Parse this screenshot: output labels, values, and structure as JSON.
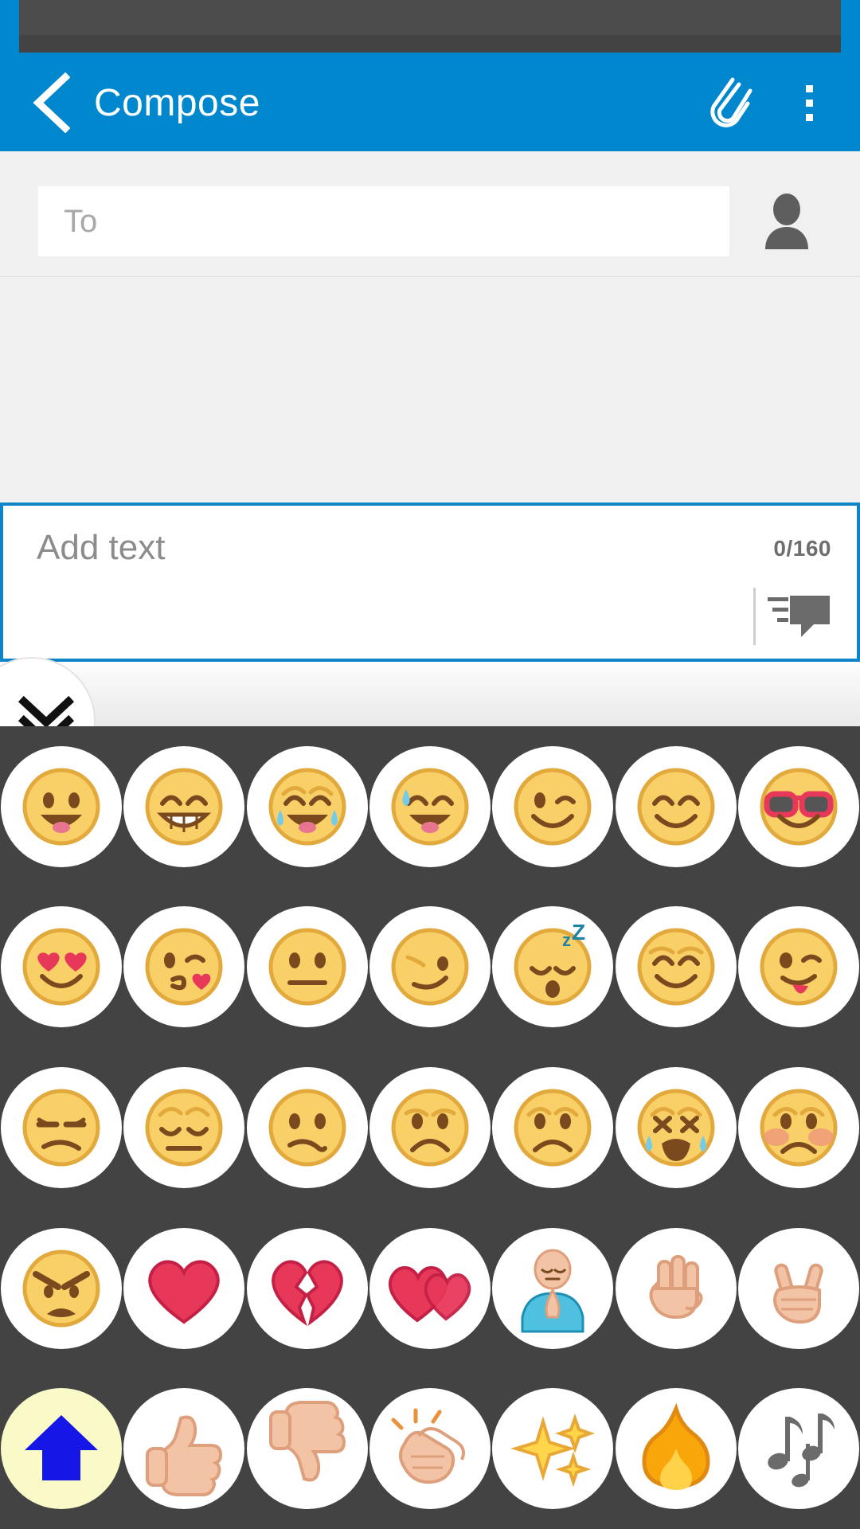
{
  "app": {
    "title": "Compose",
    "accent_color": "#0087cd",
    "keyboard_bg": "#434343",
    "key_bg": "#ffffff",
    "shift_key_bg": "#fafac8"
  },
  "appbar": {
    "back_label": "back-arrow",
    "title": "Compose",
    "attach_label": "attach",
    "overflow_label": "more options"
  },
  "recipient": {
    "placeholder": "To",
    "value": "",
    "contact_picker_label": "contacts"
  },
  "compose": {
    "placeholder": "Add text",
    "value": "",
    "counter": "0/160",
    "char_count": 0,
    "char_limit": 160,
    "send_label": "send message"
  },
  "collapse": {
    "label": "hide keyboard"
  },
  "keyboard": {
    "rows": [
      [
        {
          "name": "emoji-grinning-face-big-eyes",
          "char": "😃"
        },
        {
          "name": "emoji-beaming-face-smiling-eyes",
          "char": "😁"
        },
        {
          "name": "emoji-face-tears-of-joy",
          "char": "😂"
        },
        {
          "name": "emoji-grinning-face-sweat",
          "char": "😅"
        },
        {
          "name": "emoji-winking-face",
          "char": "😉"
        },
        {
          "name": "emoji-smiling-face-smiling-eyes",
          "char": "😊"
        },
        {
          "name": "emoji-smiling-face-sunglasses",
          "char": "😎"
        }
      ],
      [
        {
          "name": "emoji-smiling-face-heart-eyes",
          "char": "😍"
        },
        {
          "name": "emoji-face-blowing-kiss",
          "char": "😘"
        },
        {
          "name": "emoji-neutral-face",
          "char": "😐"
        },
        {
          "name": "emoji-smirking-face",
          "char": "😏"
        },
        {
          "name": "emoji-sleeping-face",
          "char": "😴"
        },
        {
          "name": "emoji-relieved-face",
          "char": "😌"
        },
        {
          "name": "emoji-winking-face-tongue",
          "char": "😜"
        }
      ],
      [
        {
          "name": "emoji-unamused-face",
          "char": "😒"
        },
        {
          "name": "emoji-pensive-face",
          "char": "😔"
        },
        {
          "name": "emoji-confused-face",
          "char": "😕"
        },
        {
          "name": "emoji-frowning-face",
          "char": "🙁"
        },
        {
          "name": "emoji-worried-face",
          "char": "😟"
        },
        {
          "name": "emoji-loudly-crying-face",
          "char": "😭"
        },
        {
          "name": "emoji-sad-blushing-face",
          "char": "😞"
        }
      ],
      [
        {
          "name": "emoji-angry-face",
          "char": "😠"
        },
        {
          "name": "emoji-red-heart",
          "char": "❤️"
        },
        {
          "name": "emoji-broken-heart",
          "char": "💔"
        },
        {
          "name": "emoji-two-hearts",
          "char": "💕"
        },
        {
          "name": "emoji-person-praying",
          "char": "🙏"
        },
        {
          "name": "emoji-raised-hand",
          "char": "🤚"
        },
        {
          "name": "emoji-victory-hand",
          "char": "✌️"
        }
      ],
      [
        {
          "name": "keyboard-shift-key",
          "char": "shift"
        },
        {
          "name": "emoji-thumbs-up",
          "char": "👍"
        },
        {
          "name": "emoji-thumbs-down",
          "char": "👎"
        },
        {
          "name": "emoji-clapping-hands",
          "char": "👏"
        },
        {
          "name": "emoji-sparkles",
          "char": "✨"
        },
        {
          "name": "emoji-fire",
          "char": "🔥"
        },
        {
          "name": "emoji-musical-notes",
          "char": "🎵"
        }
      ]
    ]
  }
}
